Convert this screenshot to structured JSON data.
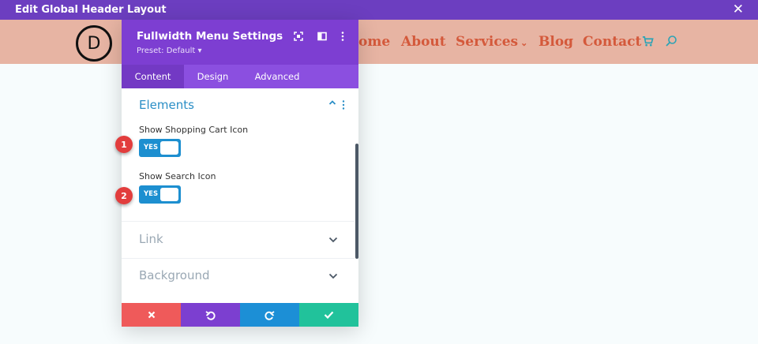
{
  "window": {
    "title": "Edit Global Header Layout",
    "close_icon": "close-icon"
  },
  "header": {
    "logo_letter": "D",
    "nav": [
      {
        "label": "Home",
        "visible_text": "ome"
      },
      {
        "label": "About"
      },
      {
        "label": "Services",
        "has_dropdown": true,
        "caret": "⌄"
      },
      {
        "label": "Blog"
      },
      {
        "label": "Contact"
      }
    ],
    "icons": [
      "shopping-cart-icon",
      "search-icon"
    ],
    "colors": {
      "bar": "#e7b4a3",
      "link": "#d4593b",
      "icon": "#2ea3b5"
    }
  },
  "panel": {
    "title": "Fullwidth Menu Settings",
    "preset": "Preset: Default ▾",
    "header_icons": [
      "fullscreen-icon",
      "split-view-icon",
      "more-options-icon"
    ],
    "tabs": [
      {
        "label": "Content",
        "active": true
      },
      {
        "label": "Design",
        "active": false
      },
      {
        "label": "Advanced",
        "active": false
      }
    ],
    "sections": {
      "elements": {
        "title": "Elements",
        "expanded": true,
        "options": [
          {
            "label": "Show Shopping Cart Icon",
            "toggle": "YES",
            "badge": "1"
          },
          {
            "label": "Show Search Icon",
            "toggle": "YES",
            "badge": "2"
          }
        ]
      },
      "link": {
        "title": "Link",
        "expanded": false
      },
      "background": {
        "title": "Background",
        "expanded": false
      }
    },
    "footer": [
      {
        "action": "discard",
        "icon": "close-icon",
        "color": "#ef5a5a"
      },
      {
        "action": "undo",
        "icon": "undo-icon",
        "color": "#7c3fd0"
      },
      {
        "action": "redo",
        "icon": "redo-icon",
        "color": "#1c8fd6"
      },
      {
        "action": "save",
        "icon": "check-icon",
        "color": "#21c29b"
      }
    ],
    "colors": {
      "header": "#7d3ed2",
      "tabs": "#8b4fe0",
      "section_title": "#2a8ec6",
      "toggle": "#1d8fd0"
    }
  }
}
